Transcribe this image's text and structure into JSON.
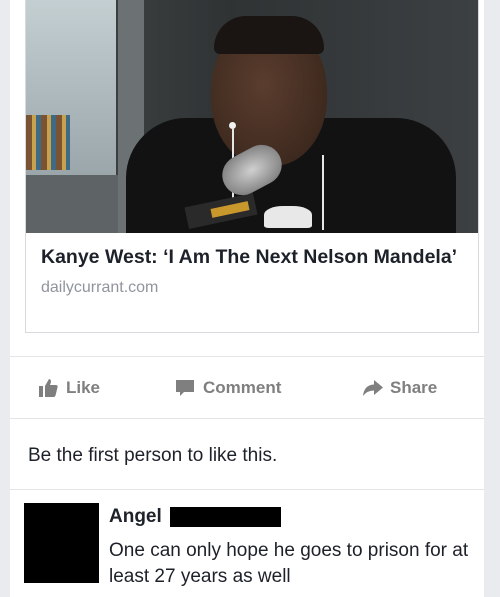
{
  "link_preview": {
    "title": "Kanye West: ‘I Am The Next Nelson Mandela’",
    "domain": "dailycurrant.com"
  },
  "actions": {
    "like_label": "Like",
    "comment_label": "Comment",
    "share_label": "Share",
    "like_icon": "thumbs-up-icon",
    "comment_icon": "speech-bubble-icon",
    "share_icon": "share-arrow-icon"
  },
  "likes_summary": "Be the first person to like this.",
  "comment": {
    "author": "Angel",
    "text": "One can only hope he goes to prison for at least 27 years as well"
  },
  "colors": {
    "text": "#1d2129",
    "muted": "#90949c",
    "action": "#7f7f7f",
    "background": "#e9ebee"
  }
}
